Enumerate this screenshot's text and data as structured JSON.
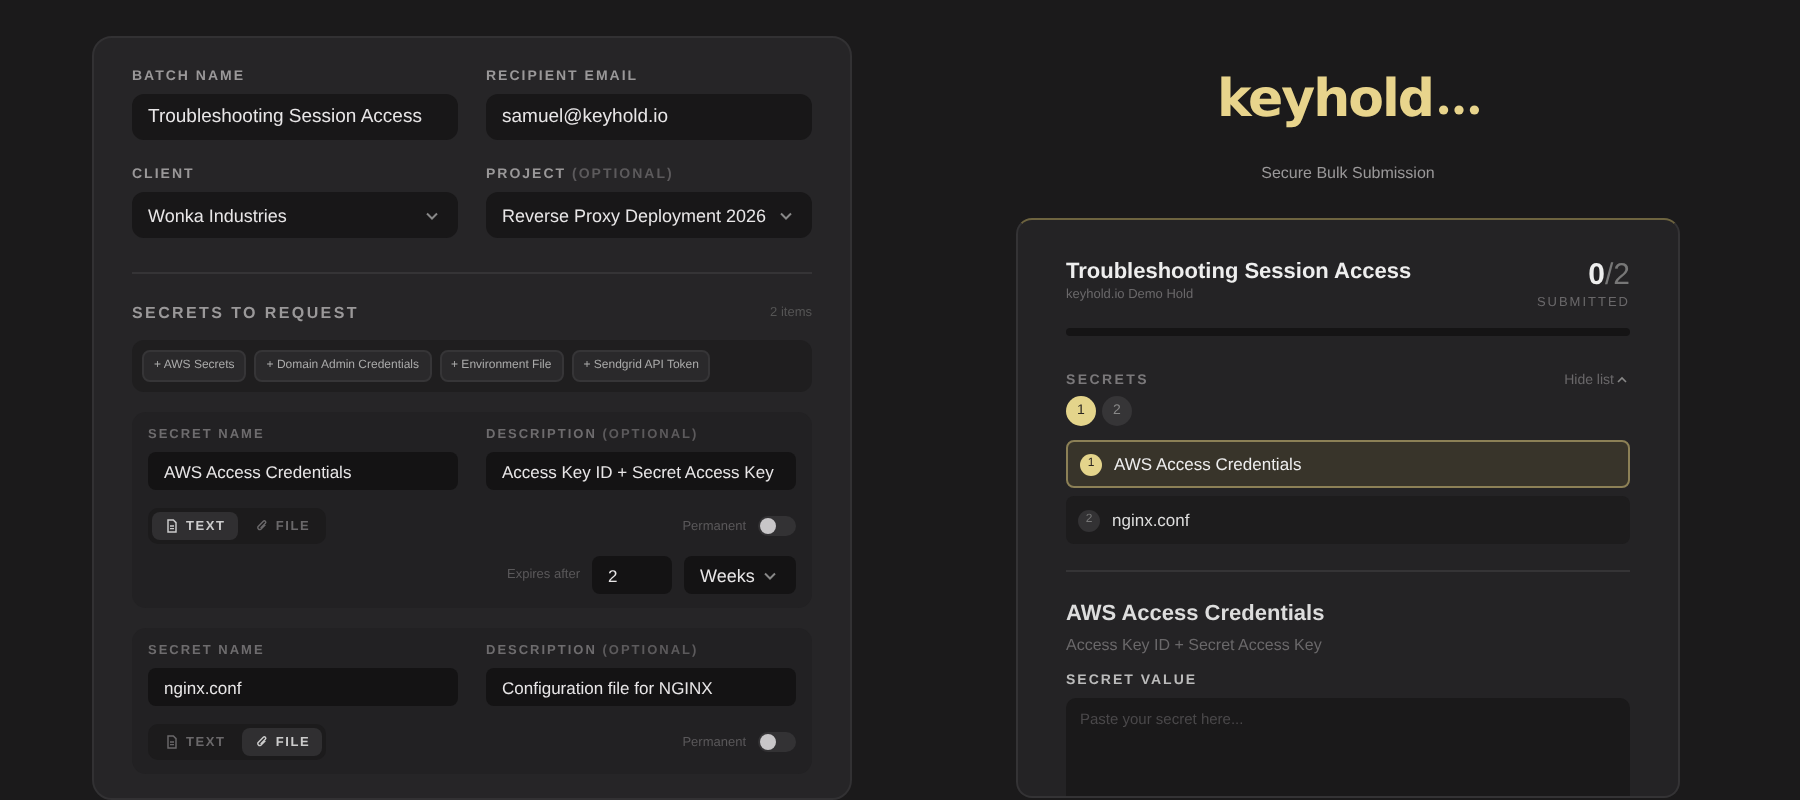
{
  "form": {
    "fields": [
      {
        "label": "BATCH NAME",
        "value": "Troubleshooting Session Access",
        "kind": "input"
      },
      {
        "label": "RECIPIENT EMAIL",
        "value": "samuel@keyhold.io",
        "kind": "input"
      },
      {
        "label": "CLIENT",
        "value": "Wonka Industries",
        "kind": "select"
      },
      {
        "label": "PROJECT",
        "optional": "(OPTIONAL)",
        "value": "Reverse Proxy Deployment 2026",
        "kind": "select"
      }
    ],
    "secrets_heading": "SECRETS TO REQUEST",
    "secrets_count": "2 items",
    "templates": [
      "+ AWS Secrets",
      "+ Domain Admin Credentials",
      "+ Environment File",
      "+ Sendgrid API Token"
    ],
    "secrets": [
      {
        "name_label": "SECRET NAME",
        "name": "AWS Access Credentials",
        "desc_label": "DESCRIPTION",
        "desc_optional": "(OPTIONAL)",
        "description": "Access Key ID + Secret Access Key",
        "types": [
          {
            "label": "TEXT",
            "kind": "text",
            "selected": true
          },
          {
            "label": "FILE",
            "kind": "file",
            "selected": false
          }
        ],
        "permanent_label": "Permanent",
        "permanent": false,
        "expires": {
          "label": "Expires after",
          "amount": "2",
          "unit": "Weeks"
        }
      },
      {
        "name_label": "SECRET NAME",
        "name": "nginx.conf",
        "desc_label": "DESCRIPTION",
        "desc_optional": "(OPTIONAL)",
        "description": "Configuration file for NGINX",
        "types": [
          {
            "label": "TEXT",
            "kind": "text",
            "selected": false
          },
          {
            "label": "FILE",
            "kind": "file",
            "selected": true
          }
        ],
        "permanent_label": "Permanent",
        "permanent": false
      }
    ]
  },
  "preview": {
    "logo": "keyhold",
    "subtitle": "Secure Bulk Submission",
    "title": "Troubleshooting Session Access",
    "org": "keyhold.io Demo Hold",
    "submitted": "0",
    "total": "/2",
    "submitted_label": "SUBMITTED",
    "level": 0,
    "secrets_label": "SECRETS",
    "hide_list": "Hide list",
    "steps": [
      {
        "label": "1",
        "selected": true
      },
      {
        "label": "2",
        "selected": false
      }
    ],
    "items": [
      {
        "number": "1",
        "name": "AWS Access Credentials",
        "selected": true
      },
      {
        "number": "2",
        "name": "nginx.conf",
        "selected": false
      }
    ],
    "detail_title": "AWS Access Credentials",
    "detail_desc": "Access Key ID + Secret Access Key",
    "value_label": "SECRET VALUE",
    "value_placeholder": "Paste your secret here..."
  }
}
